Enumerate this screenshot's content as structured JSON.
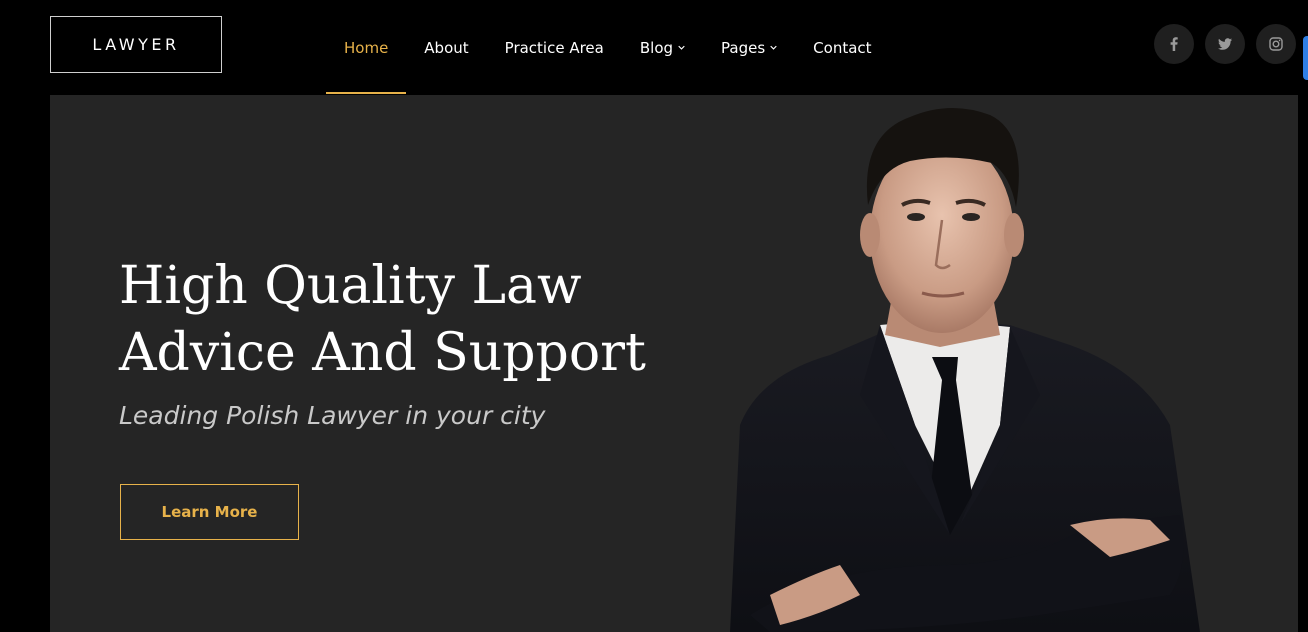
{
  "header": {
    "logo": "LAWYER",
    "nav": [
      {
        "label": "Home",
        "active": true
      },
      {
        "label": "About"
      },
      {
        "label": "Practice Area"
      },
      {
        "label": "Blog",
        "dropdown": true
      },
      {
        "label": "Pages",
        "dropdown": true
      },
      {
        "label": "Contact"
      }
    ],
    "socials": [
      {
        "icon": "facebook-icon"
      },
      {
        "icon": "twitter-icon"
      },
      {
        "icon": "instagram-icon"
      }
    ]
  },
  "hero": {
    "title_line1": "High Quality Law",
    "title_line2": "Advice And Support",
    "subtitle": "Leading Polish Lawyer in your city",
    "button": "Learn More"
  },
  "colors": {
    "accent": "#e7b24a",
    "background": "#000000",
    "hero_background": "#252525",
    "social_background": "#1f1f1f"
  }
}
